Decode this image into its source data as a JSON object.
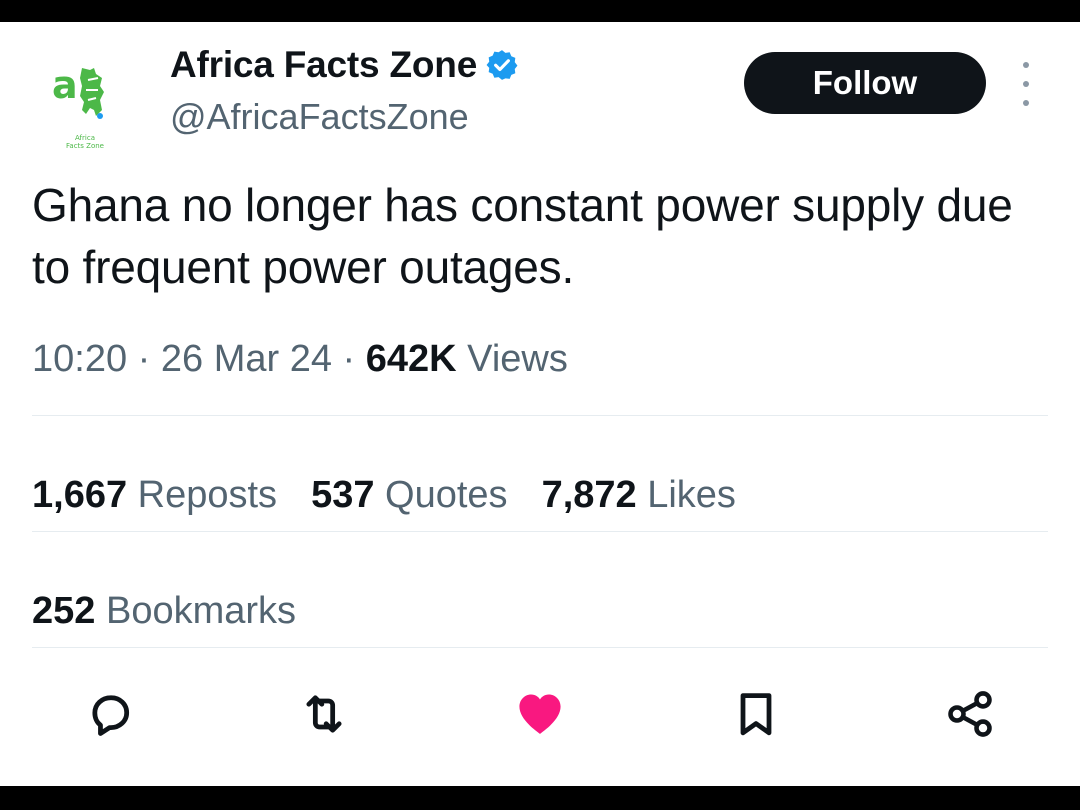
{
  "account": {
    "name": "Africa Facts Zone",
    "handle": "@AfricaFactsZone",
    "avatar_text": "Africa Facts Zone",
    "verified_icon": "verified-badge-icon"
  },
  "header": {
    "follow_label": "Follow",
    "more_icon": "more-vertical-icon"
  },
  "tweet": {
    "text": "Ghana no longer has constant power supply due to frequent power outages.",
    "time": "10:20",
    "date": "26 Mar 24",
    "views_count": "642K",
    "views_label": "Views"
  },
  "stats": {
    "reposts_count": "1,667",
    "reposts_label": "Reposts",
    "quotes_count": "537",
    "quotes_label": "Quotes",
    "likes_count": "7,872",
    "likes_label": "Likes",
    "bookmarks_count": "252",
    "bookmarks_label": "Bookmarks"
  },
  "actions": [
    {
      "icon": "reply-icon"
    },
    {
      "icon": "repost-icon"
    },
    {
      "icon": "like-heart-icon",
      "liked": true
    },
    {
      "icon": "bookmark-icon"
    },
    {
      "icon": "share-icon"
    }
  ],
  "colors": {
    "background": "#ffffff",
    "frame": "#000000",
    "text_primary": "#0f1419",
    "text_secondary": "#536471",
    "verified_blue": "#1d9bf0",
    "like_pink": "#f91880",
    "logo_green": "#4cb848",
    "follow_bg": "#0f1419"
  }
}
